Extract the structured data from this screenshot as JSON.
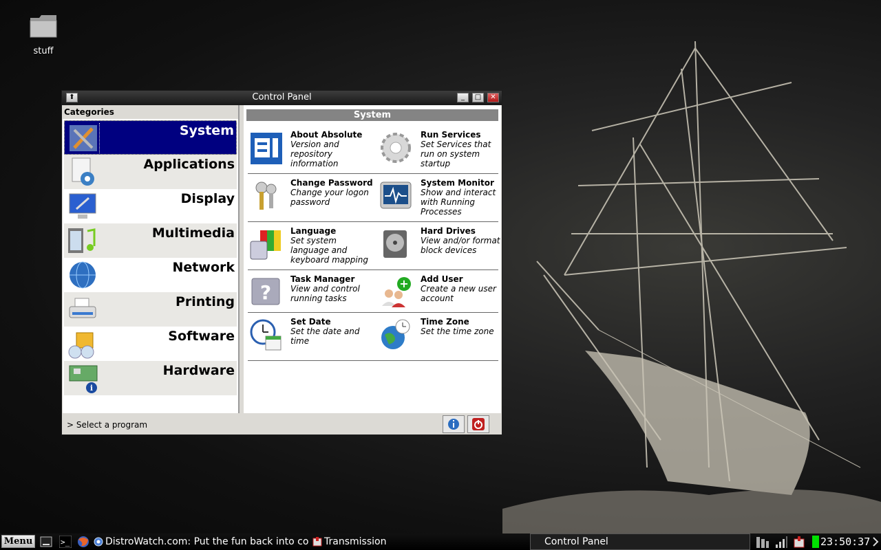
{
  "desktop": {
    "icons": [
      {
        "label": "stuff",
        "icon": "folder-icon"
      }
    ]
  },
  "window": {
    "title": "Control Panel",
    "categories_header": "Categories",
    "categories": [
      {
        "label": "System",
        "icon": "system-tools-icon",
        "selected": true
      },
      {
        "label": "Applications",
        "icon": "applications-icon"
      },
      {
        "label": "Display",
        "icon": "display-icon"
      },
      {
        "label": "Multimedia",
        "icon": "multimedia-icon"
      },
      {
        "label": "Network",
        "icon": "network-globe-icon"
      },
      {
        "label": "Printing",
        "icon": "printer-icon"
      },
      {
        "label": "Software",
        "icon": "software-icon"
      },
      {
        "label": "Hardware",
        "icon": "hardware-icon"
      }
    ],
    "section_title": "System",
    "programs": [
      {
        "title": "About Absolute",
        "desc": "Version and repository information",
        "icon": "about-icon"
      },
      {
        "title": "Run Services",
        "desc": "Set Services that run on system startup",
        "icon": "gear-icon"
      },
      {
        "title": "Change Password",
        "desc": "Change your logon password",
        "icon": "keys-icon"
      },
      {
        "title": "System Monitor",
        "desc": "Show and interact with Running Processes",
        "icon": "monitor-icon"
      },
      {
        "title": "Language",
        "desc": "Set system language and keyboard mapping",
        "icon": "language-icon"
      },
      {
        "title": "Hard Drives",
        "desc": "View and/or format block devices",
        "icon": "hard-drive-icon"
      },
      {
        "title": "Task Manager",
        "desc": "View and control running tasks",
        "icon": "task-manager-icon"
      },
      {
        "title": "Add User",
        "desc": "Create a new user account",
        "icon": "add-user-icon"
      },
      {
        "title": "Set Date",
        "desc": "Set the date and time",
        "icon": "calendar-clock-icon"
      },
      {
        "title": "Time Zone",
        "desc": "Set the time zone",
        "icon": "globe-clock-icon"
      }
    ],
    "status": "> Select a program"
  },
  "taskbar": {
    "menu_label": "Menu",
    "tasks": [
      {
        "label": "DistroWatch.com: Put the fun back into com...",
        "icon": "browser-icon"
      },
      {
        "label": "Transmission",
        "icon": "transmission-icon"
      },
      {
        "label": "Control Panel",
        "active": true
      }
    ],
    "clock": "23:50:37"
  },
  "colors": {
    "selection": "#000080",
    "section_header": "#848484",
    "battery": "#00e000"
  }
}
